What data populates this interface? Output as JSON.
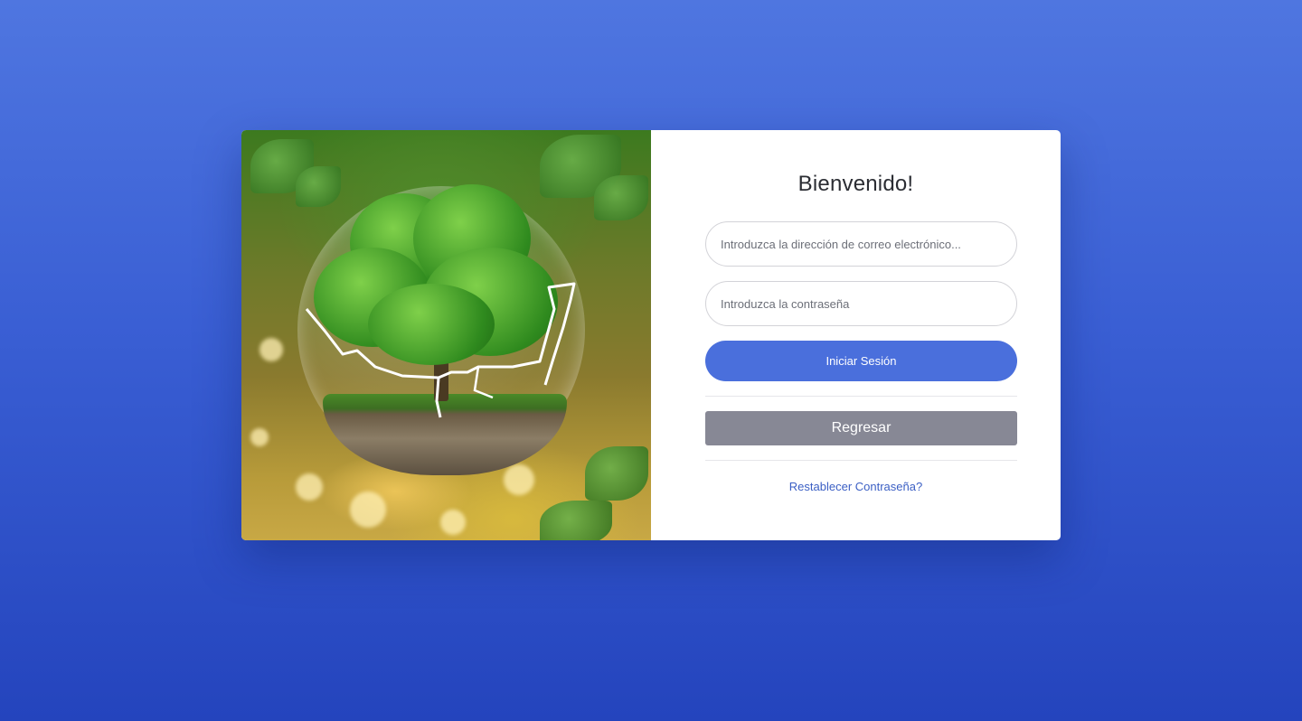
{
  "login": {
    "title": "Bienvenido!",
    "email": {
      "placeholder": "Introduzca la dirección de correo electrónico...",
      "value": ""
    },
    "password": {
      "placeholder": "Introduzca la contraseña",
      "value": ""
    },
    "login_button": "Iniciar Sesión",
    "back_button": "Regresar",
    "reset_link": "Restablecer Contraseña?"
  },
  "colors": {
    "background_top": "#4f76e0",
    "background_bottom": "#2444bd",
    "primary_button": "#4a6fdc",
    "secondary_button": "#878895",
    "link": "#3b5fc4"
  },
  "image": {
    "subject": "tree-in-cracked-glass-sphere"
  }
}
